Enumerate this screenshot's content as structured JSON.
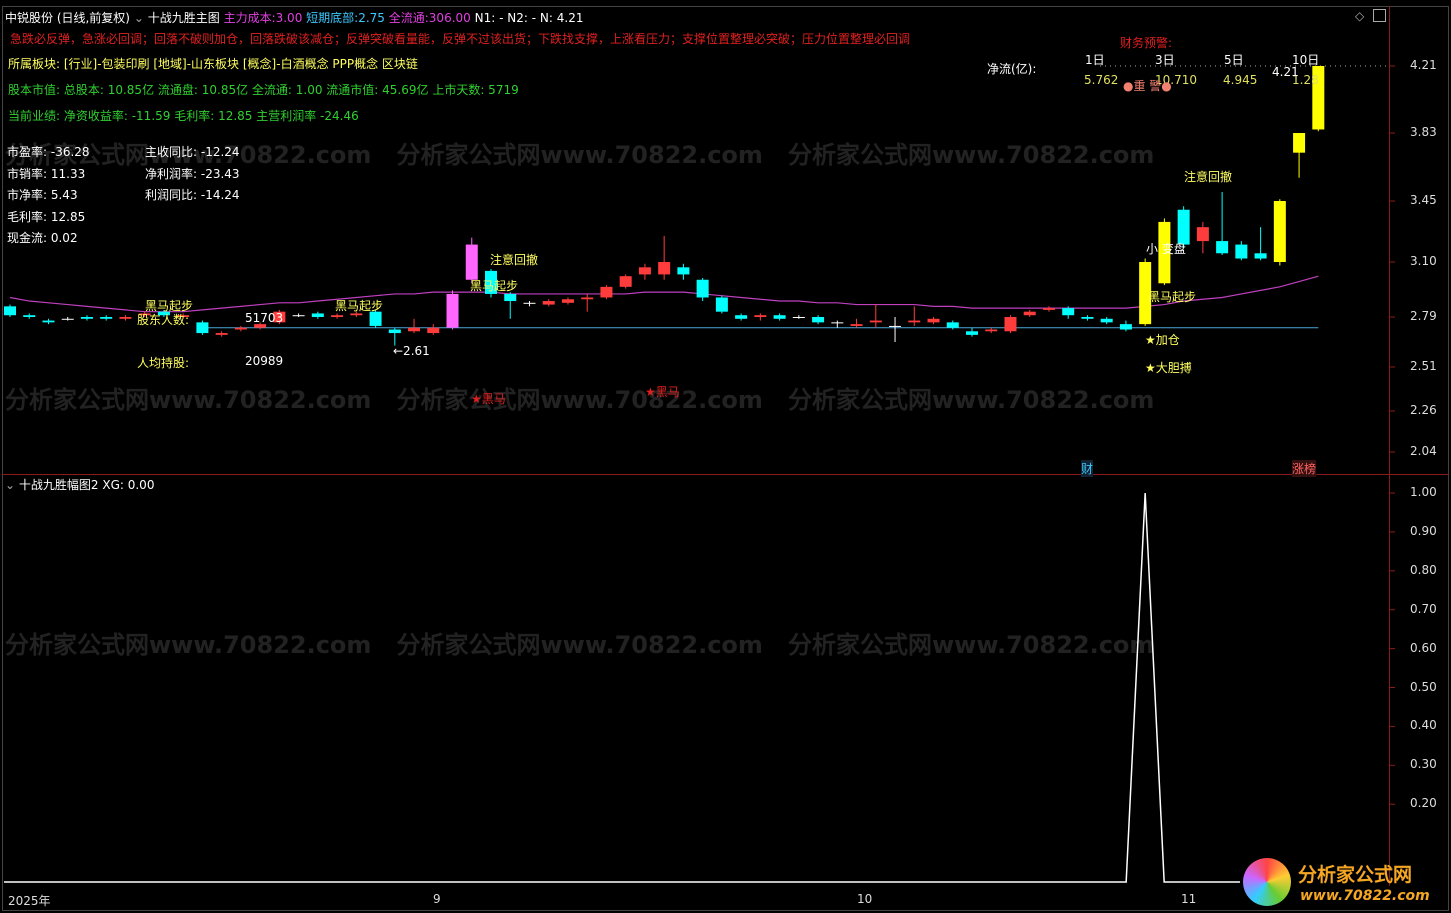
{
  "header": {
    "stock": "中锐股份 (日线,前复权)",
    "indicator": "十战九胜主图",
    "cost_label": "主力成本:",
    "cost": "3.00",
    "bottom_label": "短期底部:",
    "bottom": "2.75",
    "float_label": "全流通:",
    "float": "306.00",
    "n1": "N1: -",
    "n2": "N2: -",
    "n": "N: 4.21"
  },
  "info": {
    "motto": "急跌必反弹，急涨必回调；回落不破则加仓，回落跌破该减仓；反弹突破看量能，反弹不过该出货；下跌找支撑，上涨看压力；支撑位置整理必突破；压力位置整理必回调",
    "sector": "所属板块: [行业]-包装印刷 [地域]-山东板块 [概念]-白酒概念 PPP概念 区块链",
    "capital": "股本市值: 总股本: 10.85亿 流通盘: 10.85亿 全流通: 1.00 流通市值: 45.69亿 上市天数: 5719",
    "perf": "当前业绩:  净资收益率: -11.59 毛利率: 12.85 主营利润率 -24.46",
    "left": [
      "市盈率: -36.28",
      "市销率: 11.33",
      "市净率: 5.43",
      "毛利率: 12.85",
      "现金流: 0.02"
    ],
    "right": [
      "主收同比: -12.24",
      "净利润率: -23.43",
      "利润同比: -14.24"
    ],
    "holders_label": "股东人数:",
    "holders": "51703",
    "avg_label": "人均持股:",
    "avg": "20989"
  },
  "flow": {
    "warn": "财务预警:",
    "label": "净流(亿):",
    "days": [
      "1日",
      "3日",
      "5日",
      "10日"
    ],
    "values": [
      "5.762",
      "10.710",
      "4.945",
      "1.28"
    ],
    "alert": "●重 警●",
    "price_tag": "4.21"
  },
  "annotations": {
    "hm1": "黑马起步",
    "hm2": "黑马起步",
    "hm3": "黑马起步",
    "hm4": "黑马起步",
    "hm5": "黑马起步",
    "pull1": "注意回撤",
    "pull2": "注意回撤",
    "small": "小 变盘",
    "add": "★加仓",
    "bold": "★大胆搏",
    "star1": "★黑马",
    "star2": "★黑马",
    "low": "←2.61",
    "cai": "财",
    "zt": "涨榜"
  },
  "lower": {
    "title": "十战九胜幅图2",
    "xg": "XG: 0.00"
  },
  "xaxis": [
    "2025年",
    "9",
    "10",
    "11"
  ],
  "logo": {
    "name": "分析家公式网",
    "url": "www.70822.com"
  },
  "chart_data": {
    "type": "candlestick",
    "price_ticks": [
      4.21,
      3.83,
      3.45,
      3.1,
      2.79,
      2.51,
      2.26,
      2.04
    ],
    "lower_ticks": [
      "1.00",
      "0.90",
      "0.80",
      "0.70",
      "0.60",
      "0.50",
      "0.40",
      "0.30",
      "0.20"
    ],
    "candles": [
      [
        2.85,
        2.8,
        2.86,
        2.79
      ],
      [
        2.8,
        2.79,
        2.81,
        2.78
      ],
      [
        2.77,
        2.76,
        2.78,
        2.75
      ],
      [
        2.78,
        2.78,
        2.79,
        2.77
      ],
      [
        2.79,
        2.78,
        2.8,
        2.77
      ],
      [
        2.79,
        2.78,
        2.8,
        2.77
      ],
      [
        2.78,
        2.79,
        2.8,
        2.77
      ],
      [
        2.8,
        2.81,
        2.82,
        2.79
      ],
      [
        2.82,
        2.8,
        2.83,
        2.79
      ],
      [
        2.79,
        2.8,
        2.81,
        2.78
      ],
      [
        2.76,
        2.7,
        2.77,
        2.69
      ],
      [
        2.69,
        2.7,
        2.71,
        2.68
      ],
      [
        2.72,
        2.73,
        2.74,
        2.71
      ],
      [
        2.73,
        2.75,
        2.76,
        2.72
      ],
      [
        2.76,
        2.82,
        2.83,
        2.75
      ],
      [
        2.8,
        2.8,
        2.81,
        2.79
      ],
      [
        2.81,
        2.79,
        2.82,
        2.78
      ],
      [
        2.79,
        2.8,
        2.81,
        2.78
      ],
      [
        2.8,
        2.81,
        2.82,
        2.79
      ],
      [
        2.82,
        2.74,
        2.83,
        2.73
      ],
      [
        2.72,
        2.7,
        2.73,
        2.63
      ],
      [
        2.71,
        2.73,
        2.78,
        2.7
      ],
      [
        2.7,
        2.73,
        2.75,
        2.69
      ],
      [
        2.73,
        2.92,
        2.94,
        2.72
      ],
      [
        3.0,
        3.2,
        3.24,
        2.98
      ],
      [
        3.05,
        2.92,
        3.06,
        2.9
      ],
      [
        2.92,
        2.88,
        2.93,
        2.78
      ],
      [
        2.87,
        2.87,
        2.88,
        2.85
      ],
      [
        2.86,
        2.88,
        2.89,
        2.85
      ],
      [
        2.87,
        2.89,
        2.9,
        2.86
      ],
      [
        2.89,
        2.9,
        2.92,
        2.82
      ],
      [
        2.9,
        2.96,
        2.97,
        2.89
      ],
      [
        2.96,
        3.02,
        3.03,
        2.95
      ],
      [
        3.03,
        3.07,
        3.09,
        3.0
      ],
      [
        3.03,
        3.1,
        3.25,
        3.0
      ],
      [
        3.07,
        3.03,
        3.09,
        3.0
      ],
      [
        3.0,
        2.9,
        3.01,
        2.88
      ],
      [
        2.9,
        2.82,
        2.91,
        2.81
      ],
      [
        2.8,
        2.78,
        2.81,
        2.77
      ],
      [
        2.79,
        2.8,
        2.81,
        2.77
      ],
      [
        2.8,
        2.78,
        2.81,
        2.77
      ],
      [
        2.79,
        2.79,
        2.8,
        2.78
      ],
      [
        2.79,
        2.76,
        2.8,
        2.75
      ],
      [
        2.76,
        2.76,
        2.77,
        2.73
      ],
      [
        2.74,
        2.75,
        2.78,
        2.73
      ],
      [
        2.76,
        2.77,
        2.86,
        2.73
      ],
      [
        2.74,
        2.74,
        2.79,
        2.65
      ],
      [
        2.76,
        2.77,
        2.85,
        2.74
      ],
      [
        2.76,
        2.78,
        2.79,
        2.75
      ],
      [
        2.76,
        2.73,
        2.77,
        2.72
      ],
      [
        2.71,
        2.69,
        2.73,
        2.68
      ],
      [
        2.71,
        2.72,
        2.73,
        2.7
      ],
      [
        2.71,
        2.79,
        2.8,
        2.7
      ],
      [
        2.8,
        2.82,
        2.83,
        2.79
      ],
      [
        2.83,
        2.84,
        2.85,
        2.82
      ],
      [
        2.84,
        2.8,
        2.85,
        2.78
      ],
      [
        2.79,
        2.78,
        2.8,
        2.77
      ],
      [
        2.78,
        2.76,
        2.79,
        2.75
      ],
      [
        2.75,
        2.72,
        2.77,
        2.71
      ],
      [
        2.75,
        3.1,
        3.12,
        2.74
      ],
      [
        2.98,
        3.33,
        3.35,
        2.97
      ],
      [
        3.4,
        3.2,
        3.42,
        3.18
      ],
      [
        3.22,
        3.3,
        3.33,
        3.15
      ],
      [
        3.22,
        3.15,
        3.5,
        3.14
      ],
      [
        3.2,
        3.12,
        3.22,
        3.11
      ],
      [
        3.15,
        3.12,
        3.3,
        3.11
      ],
      [
        3.1,
        3.45,
        3.46,
        3.08
      ],
      [
        3.72,
        3.83,
        3.83,
        3.58
      ],
      [
        3.85,
        4.21,
        4.21,
        3.84
      ]
    ],
    "candle_colors": {
      "59": "#ffff00",
      "60": "#ffff00",
      "66": "#ffff00",
      "67": "#ffff00",
      "68": "#ffff00",
      "23": "#ff66ff",
      "24": "#ff66ff"
    },
    "ma": [
      2.9,
      2.88,
      2.87,
      2.86,
      2.85,
      2.84,
      2.83,
      2.82,
      2.82,
      2.82,
      2.83,
      2.84,
      2.85,
      2.86,
      2.87,
      2.87,
      2.88,
      2.89,
      2.9,
      2.91,
      2.92,
      2.92,
      2.93,
      2.93,
      2.93,
      2.93,
      2.92,
      2.92,
      2.92,
      2.92,
      2.92,
      2.92,
      2.92,
      2.93,
      2.93,
      2.93,
      2.92,
      2.91,
      2.9,
      2.89,
      2.88,
      2.88,
      2.87,
      2.87,
      2.86,
      2.86,
      2.86,
      2.86,
      2.85,
      2.85,
      2.84,
      2.84,
      2.84,
      2.84,
      2.84,
      2.84,
      2.84,
      2.84,
      2.84,
      2.85,
      2.86,
      2.88,
      2.89,
      2.9,
      2.92,
      2.94,
      2.96,
      2.99,
      3.02
    ],
    "support": 2.73,
    "signal_index": 59
  }
}
